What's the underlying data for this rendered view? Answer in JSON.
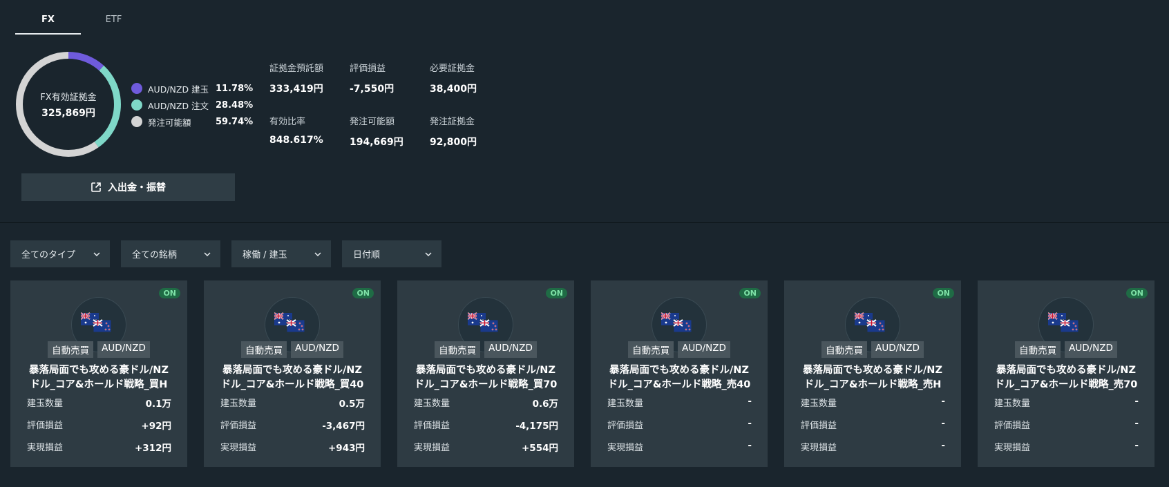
{
  "tabs": [
    {
      "label": "FX",
      "active": true
    },
    {
      "label": "ETF",
      "active": false
    }
  ],
  "donut": {
    "title": "FX有効証拠金",
    "value": "325,869円",
    "segments": [
      {
        "label": "AUD/NZD 建玉",
        "percent_text": "11.78%",
        "percent": 11.78,
        "color": "#6f5bdc"
      },
      {
        "label": "AUD/NZD 注文",
        "percent_text": "28.48%",
        "percent": 28.48,
        "color": "#7fd8c8"
      },
      {
        "label": "発注可能額",
        "percent_text": "59.74%",
        "percent": 59.74,
        "color": "#d4d4d4"
      }
    ]
  },
  "stats": [
    {
      "label": "証拠金預託額",
      "value": "333,419円"
    },
    {
      "label": "評価損益",
      "value": "-7,550円"
    },
    {
      "label": "必要証拠金",
      "value": "38,400円"
    },
    {
      "label": "有効比率",
      "value": "848.617%"
    },
    {
      "label": "発注可能額",
      "value": "194,669円"
    },
    {
      "label": "発注証拠金",
      "value": "92,800円"
    }
  ],
  "deposit_button": {
    "label": "入出金・振替",
    "icon": "external-link-icon"
  },
  "filters": [
    {
      "label": "全てのタイプ"
    },
    {
      "label": "全ての銘柄"
    },
    {
      "label": "稼働 / 建玉"
    },
    {
      "label": "日付順"
    }
  ],
  "cards": [
    {
      "status": "ON",
      "type_tag": "自動売買",
      "pair_tag": "AUD/NZD",
      "title_line1": "暴落局面でも攻める豪ドル/NZ",
      "title_line2": "ドル_コア&ホールド戦略_買H",
      "rows": [
        {
          "label": "建玉数量",
          "value": "0.1万"
        },
        {
          "label": "評価損益",
          "value": "+92円"
        },
        {
          "label": "実現損益",
          "value": "+312円"
        }
      ]
    },
    {
      "status": "ON",
      "type_tag": "自動売買",
      "pair_tag": "AUD/NZD",
      "title_line1": "暴落局面でも攻める豪ドル/NZ",
      "title_line2": "ドル_コア&ホールド戦略_買40",
      "rows": [
        {
          "label": "建玉数量",
          "value": "0.5万"
        },
        {
          "label": "評価損益",
          "value": "-3,467円"
        },
        {
          "label": "実現損益",
          "value": "+943円"
        }
      ]
    },
    {
      "status": "ON",
      "type_tag": "自動売買",
      "pair_tag": "AUD/NZD",
      "title_line1": "暴落局面でも攻める豪ドル/NZ",
      "title_line2": "ドル_コア&ホールド戦略_買70",
      "rows": [
        {
          "label": "建玉数量",
          "value": "0.6万"
        },
        {
          "label": "評価損益",
          "value": "-4,175円"
        },
        {
          "label": "実現損益",
          "value": "+554円"
        }
      ]
    },
    {
      "status": "ON",
      "type_tag": "自動売買",
      "pair_tag": "AUD/NZD",
      "title_line1": "暴落局面でも攻める豪ドル/NZ",
      "title_line2": "ドル_コア&ホールド戦略_売40",
      "rows": [
        {
          "label": "建玉数量",
          "value": "-"
        },
        {
          "label": "評価損益",
          "value": "-"
        },
        {
          "label": "実現損益",
          "value": "-"
        }
      ]
    },
    {
      "status": "ON",
      "type_tag": "自動売買",
      "pair_tag": "AUD/NZD",
      "title_line1": "暴落局面でも攻める豪ドル/NZ",
      "title_line2": "ドル_コア&ホールド戦略_売H",
      "rows": [
        {
          "label": "建玉数量",
          "value": "-"
        },
        {
          "label": "評価損益",
          "value": "-"
        },
        {
          "label": "実現損益",
          "value": "-"
        }
      ]
    },
    {
      "status": "ON",
      "type_tag": "自動売買",
      "pair_tag": "AUD/NZD",
      "title_line1": "暴落局面でも攻める豪ドル/NZ",
      "title_line2": "ドル_コア&ホールド戦略_売70",
      "rows": [
        {
          "label": "建玉数量",
          "value": "-"
        },
        {
          "label": "評価損益",
          "value": "-"
        },
        {
          "label": "実現損益",
          "value": "-"
        }
      ]
    }
  ]
}
